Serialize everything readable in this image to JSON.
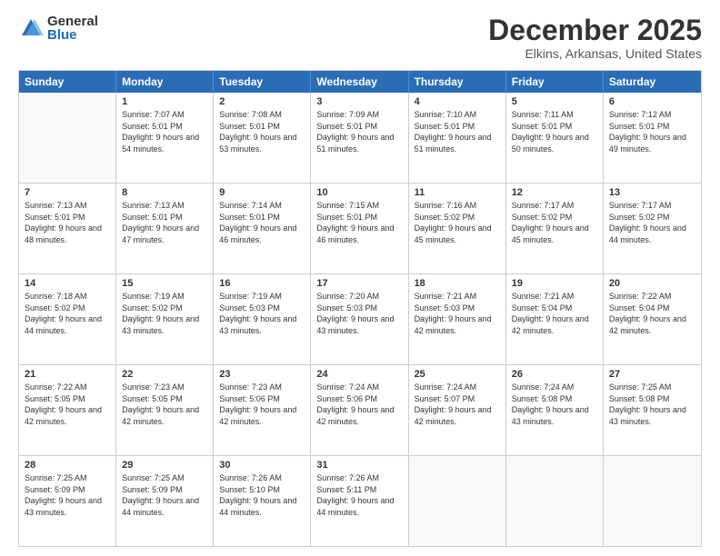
{
  "logo": {
    "general": "General",
    "blue": "Blue"
  },
  "title": {
    "month": "December 2025",
    "location": "Elkins, Arkansas, United States"
  },
  "calendar": {
    "headers": [
      "Sunday",
      "Monday",
      "Tuesday",
      "Wednesday",
      "Thursday",
      "Friday",
      "Saturday"
    ],
    "rows": [
      [
        {
          "day": "",
          "empty": true
        },
        {
          "day": "1",
          "sunrise": "Sunrise: 7:07 AM",
          "sunset": "Sunset: 5:01 PM",
          "daylight": "Daylight: 9 hours and 54 minutes."
        },
        {
          "day": "2",
          "sunrise": "Sunrise: 7:08 AM",
          "sunset": "Sunset: 5:01 PM",
          "daylight": "Daylight: 9 hours and 53 minutes."
        },
        {
          "day": "3",
          "sunrise": "Sunrise: 7:09 AM",
          "sunset": "Sunset: 5:01 PM",
          "daylight": "Daylight: 9 hours and 51 minutes."
        },
        {
          "day": "4",
          "sunrise": "Sunrise: 7:10 AM",
          "sunset": "Sunset: 5:01 PM",
          "daylight": "Daylight: 9 hours and 51 minutes."
        },
        {
          "day": "5",
          "sunrise": "Sunrise: 7:11 AM",
          "sunset": "Sunset: 5:01 PM",
          "daylight": "Daylight: 9 hours and 50 minutes."
        },
        {
          "day": "6",
          "sunrise": "Sunrise: 7:12 AM",
          "sunset": "Sunset: 5:01 PM",
          "daylight": "Daylight: 9 hours and 49 minutes."
        }
      ],
      [
        {
          "day": "7",
          "sunrise": "Sunrise: 7:13 AM",
          "sunset": "Sunset: 5:01 PM",
          "daylight": "Daylight: 9 hours and 48 minutes."
        },
        {
          "day": "8",
          "sunrise": "Sunrise: 7:13 AM",
          "sunset": "Sunset: 5:01 PM",
          "daylight": "Daylight: 9 hours and 47 minutes."
        },
        {
          "day": "9",
          "sunrise": "Sunrise: 7:14 AM",
          "sunset": "Sunset: 5:01 PM",
          "daylight": "Daylight: 9 hours and 46 minutes."
        },
        {
          "day": "10",
          "sunrise": "Sunrise: 7:15 AM",
          "sunset": "Sunset: 5:01 PM",
          "daylight": "Daylight: 9 hours and 46 minutes."
        },
        {
          "day": "11",
          "sunrise": "Sunrise: 7:16 AM",
          "sunset": "Sunset: 5:02 PM",
          "daylight": "Daylight: 9 hours and 45 minutes."
        },
        {
          "day": "12",
          "sunrise": "Sunrise: 7:17 AM",
          "sunset": "Sunset: 5:02 PM",
          "daylight": "Daylight: 9 hours and 45 minutes."
        },
        {
          "day": "13",
          "sunrise": "Sunrise: 7:17 AM",
          "sunset": "Sunset: 5:02 PM",
          "daylight": "Daylight: 9 hours and 44 minutes."
        }
      ],
      [
        {
          "day": "14",
          "sunrise": "Sunrise: 7:18 AM",
          "sunset": "Sunset: 5:02 PM",
          "daylight": "Daylight: 9 hours and 44 minutes."
        },
        {
          "day": "15",
          "sunrise": "Sunrise: 7:19 AM",
          "sunset": "Sunset: 5:02 PM",
          "daylight": "Daylight: 9 hours and 43 minutes."
        },
        {
          "day": "16",
          "sunrise": "Sunrise: 7:19 AM",
          "sunset": "Sunset: 5:03 PM",
          "daylight": "Daylight: 9 hours and 43 minutes."
        },
        {
          "day": "17",
          "sunrise": "Sunrise: 7:20 AM",
          "sunset": "Sunset: 5:03 PM",
          "daylight": "Daylight: 9 hours and 43 minutes."
        },
        {
          "day": "18",
          "sunrise": "Sunrise: 7:21 AM",
          "sunset": "Sunset: 5:03 PM",
          "daylight": "Daylight: 9 hours and 42 minutes."
        },
        {
          "day": "19",
          "sunrise": "Sunrise: 7:21 AM",
          "sunset": "Sunset: 5:04 PM",
          "daylight": "Daylight: 9 hours and 42 minutes."
        },
        {
          "day": "20",
          "sunrise": "Sunrise: 7:22 AM",
          "sunset": "Sunset: 5:04 PM",
          "daylight": "Daylight: 9 hours and 42 minutes."
        }
      ],
      [
        {
          "day": "21",
          "sunrise": "Sunrise: 7:22 AM",
          "sunset": "Sunset: 5:05 PM",
          "daylight": "Daylight: 9 hours and 42 minutes."
        },
        {
          "day": "22",
          "sunrise": "Sunrise: 7:23 AM",
          "sunset": "Sunset: 5:05 PM",
          "daylight": "Daylight: 9 hours and 42 minutes."
        },
        {
          "day": "23",
          "sunrise": "Sunrise: 7:23 AM",
          "sunset": "Sunset: 5:06 PM",
          "daylight": "Daylight: 9 hours and 42 minutes."
        },
        {
          "day": "24",
          "sunrise": "Sunrise: 7:24 AM",
          "sunset": "Sunset: 5:06 PM",
          "daylight": "Daylight: 9 hours and 42 minutes."
        },
        {
          "day": "25",
          "sunrise": "Sunrise: 7:24 AM",
          "sunset": "Sunset: 5:07 PM",
          "daylight": "Daylight: 9 hours and 42 minutes."
        },
        {
          "day": "26",
          "sunrise": "Sunrise: 7:24 AM",
          "sunset": "Sunset: 5:08 PM",
          "daylight": "Daylight: 9 hours and 43 minutes."
        },
        {
          "day": "27",
          "sunrise": "Sunrise: 7:25 AM",
          "sunset": "Sunset: 5:08 PM",
          "daylight": "Daylight: 9 hours and 43 minutes."
        }
      ],
      [
        {
          "day": "28",
          "sunrise": "Sunrise: 7:25 AM",
          "sunset": "Sunset: 5:09 PM",
          "daylight": "Daylight: 9 hours and 43 minutes."
        },
        {
          "day": "29",
          "sunrise": "Sunrise: 7:25 AM",
          "sunset": "Sunset: 5:09 PM",
          "daylight": "Daylight: 9 hours and 44 minutes."
        },
        {
          "day": "30",
          "sunrise": "Sunrise: 7:26 AM",
          "sunset": "Sunset: 5:10 PM",
          "daylight": "Daylight: 9 hours and 44 minutes."
        },
        {
          "day": "31",
          "sunrise": "Sunrise: 7:26 AM",
          "sunset": "Sunset: 5:11 PM",
          "daylight": "Daylight: 9 hours and 44 minutes."
        },
        {
          "day": "",
          "empty": true
        },
        {
          "day": "",
          "empty": true
        },
        {
          "day": "",
          "empty": true
        }
      ]
    ]
  }
}
